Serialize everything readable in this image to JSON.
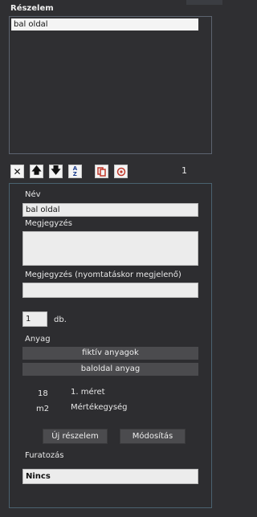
{
  "header": {
    "title": "Részelem"
  },
  "list": {
    "selected_item": "bal oldal"
  },
  "toolbar": {
    "icons": [
      "close-icon",
      "arrow-up-icon",
      "arrow-down-icon",
      "sort-az-icon",
      "copy-icon",
      "target-icon"
    ],
    "count": "1"
  },
  "form": {
    "name_label": "Név",
    "name_value": "bal oldal",
    "note_label": "Megjegyzés",
    "note_value": "",
    "print_note_label": "Megjegyzés (nyomtatáskor megjelenő)",
    "print_note_value": "",
    "quantity_value": "1",
    "quantity_unit": "db.",
    "material_label": "Anyag",
    "material_btn1": "fiktív anyagok",
    "material_btn2": "baloldal anyag",
    "size_value": "18",
    "size_label": "1. méret",
    "unit_value": "m2",
    "unit_label": "Mértékegység",
    "new_button": "Új részelem",
    "modify_button": "Módosítás",
    "drilling_label": "Furatozás",
    "drilling_value": "Nincs"
  },
  "colors": {
    "accent": "#c0392b",
    "panel_border": "#4a6270"
  }
}
